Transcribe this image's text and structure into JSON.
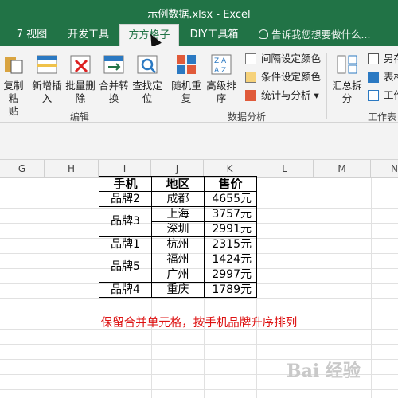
{
  "window": {
    "title": "示例数据.xlsx - Excel"
  },
  "tabs": [
    {
      "label": "7 视图"
    },
    {
      "label": "开发工具"
    },
    {
      "label": "方方格子"
    },
    {
      "label": "DIY工具箱"
    }
  ],
  "tell_me": "告诉我您想要做什么...",
  "ribbon": {
    "buttons": [
      {
        "label_top": "复制粘",
        "label_bottom": "贴"
      },
      {
        "label_top": "新增插",
        "label_bottom": "入"
      },
      {
        "label_top": "批量删",
        "label_bottom": "除"
      },
      {
        "label_top": "合并转",
        "label_bottom": "换"
      },
      {
        "label_top": "查找定",
        "label_bottom": "位"
      },
      {
        "label_top": "随机重",
        "label_bottom": "复"
      },
      {
        "label_top": "高级排",
        "label_bottom": "序"
      },
      {
        "label_top": "汇总拆",
        "label_bottom": "分"
      }
    ],
    "small": [
      {
        "label": "间隔设定颜色"
      },
      {
        "label": "条件设定颜色"
      },
      {
        "label": "统计与分析"
      },
      {
        "label": "另存"
      },
      {
        "label": "表格"
      },
      {
        "label": "工作"
      }
    ],
    "groups": [
      {
        "label": "编辑"
      },
      {
        "label": "数据分析"
      },
      {
        "label": "工作表"
      }
    ]
  },
  "columns": [
    "G",
    "H",
    "I",
    "J",
    "K",
    "L",
    "M",
    "N"
  ],
  "table": {
    "headers": [
      "手机",
      "地区",
      "售价"
    ],
    "groups": [
      {
        "phone": "品牌2",
        "rows": [
          {
            "region": "成都",
            "price": "4655元"
          }
        ]
      },
      {
        "phone": "品牌3",
        "rows": [
          {
            "region": "上海",
            "price": "3757元"
          },
          {
            "region": "深圳",
            "price": "2991元"
          }
        ]
      },
      {
        "phone": "品牌1",
        "rows": [
          {
            "region": "杭州",
            "price": "2315元"
          }
        ]
      },
      {
        "phone": "品牌5",
        "rows": [
          {
            "region": "福州",
            "price": "1424元"
          },
          {
            "region": "广州",
            "price": "2997元"
          }
        ]
      },
      {
        "phone": "品牌4",
        "rows": [
          {
            "region": "重庆",
            "price": "1789元"
          }
        ]
      }
    ]
  },
  "note": "保留合并单元格，按手机品牌升序排列",
  "watermark": "Bai 经验"
}
